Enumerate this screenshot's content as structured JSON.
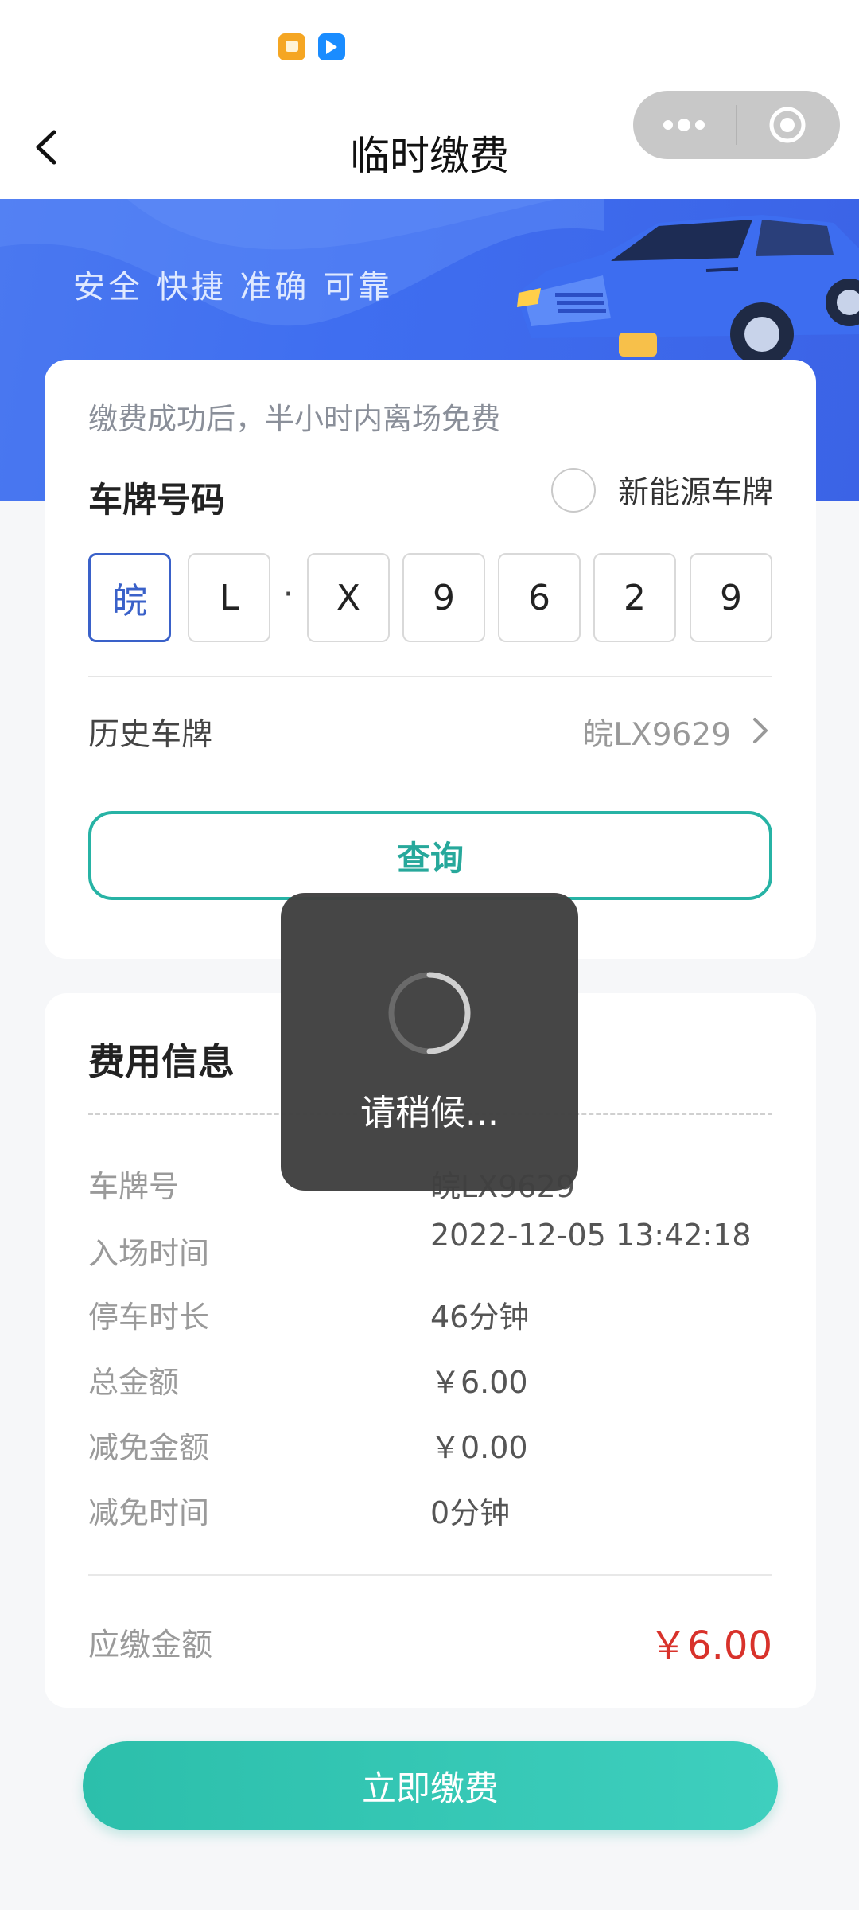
{
  "status_bar": {
    "icons": [
      "notes-app-icon",
      "messenger-app-icon"
    ]
  },
  "header": {
    "title": "临时缴费",
    "back_icon": "chevron-left-icon",
    "capsule_icons": [
      "more-dots-icon",
      "close-target-icon"
    ]
  },
  "banner": {
    "slogan": "安全  快捷  准确  可靠"
  },
  "plate_section": {
    "tip": "缴费成功后，半小时内离场免费",
    "label": "车牌号码",
    "new_energy_label": "新能源车牌",
    "new_energy_checked": false,
    "plate_chars": [
      "皖",
      "L",
      "X",
      "9",
      "6",
      "2",
      "9"
    ],
    "separator": "·",
    "history_label": "历史车牌",
    "history_value": "皖LX9629",
    "query_label": "查询"
  },
  "fee_info": {
    "title": "费用信息",
    "rows": [
      {
        "label": "车牌号",
        "value": "皖LX9629"
      },
      {
        "label": "入场时间",
        "value": "2022-12-05 13:42:18"
      },
      {
        "label": "停车时长",
        "value": "46分钟"
      },
      {
        "label": "总金额",
        "value": "￥6.00"
      },
      {
        "label": "减免金额",
        "value": "￥0.00"
      },
      {
        "label": "减免时间",
        "value": "0分钟"
      }
    ],
    "due_label": "应缴金额",
    "due_value": "￥6.00"
  },
  "pay_button": {
    "label": "立即缴费"
  },
  "loading_toast": {
    "text": "请稍候..."
  },
  "colors": {
    "accent": "#27b3a5",
    "plate_active": "#3a61c9",
    "amount_red": "#d8322b",
    "banner_blue": "#4170ef"
  }
}
